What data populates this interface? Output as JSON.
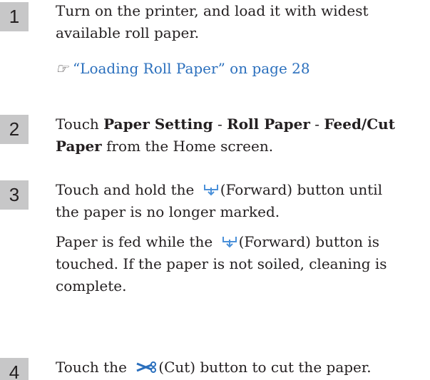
{
  "steps": [
    {
      "number": "1",
      "line1": "Turn on the printer, and load it with widest",
      "line2": "available roll paper.",
      "ref_text": "“Loading Roll Paper” on page 28"
    },
    {
      "number": "2",
      "t1": "Touch ",
      "b1": "Paper Setting",
      "t2": " - ",
      "b2": "Roll Paper",
      "t3": " - ",
      "b3": "Feed/Cut",
      "b4": "Paper",
      "t4": " from the Home screen."
    },
    {
      "number": "3",
      "line1a": "Touch and hold the ",
      "line1b": "(Forward) button until",
      "line2": "the paper is no longer marked.",
      "p2a": "Paper is fed while the ",
      "p2b": "(Forward) button is",
      "p2l2": "touched. If the paper is not soiled, cleaning is",
      "p2l3": "complete."
    },
    {
      "number": "4",
      "line1a": "Touch the ",
      "line1b": "(Cut) button to cut the paper."
    }
  ],
  "icons": {
    "reference": "reference-pointer-icon",
    "forward": "forward-feed-icon",
    "cut": "scissors-cut-icon"
  },
  "colors": {
    "badge_bg": "#c7c7c8",
    "link": "#2a6fbd",
    "forward_icon": "#4a90d9",
    "cut_icon": "#2a6fbd"
  }
}
